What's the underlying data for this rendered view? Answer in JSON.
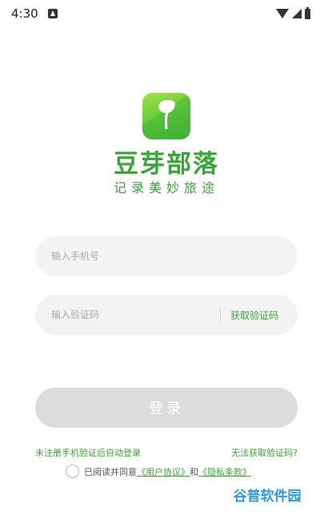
{
  "status_bar": {
    "time": "4:30",
    "icons": [
      "notification-icon",
      "wifi-icon",
      "signal-icon",
      "battery-icon"
    ]
  },
  "brand": {
    "name": "豆芽部落",
    "slogan": "记录美妙旅途",
    "color": "#3aa33a"
  },
  "form": {
    "phone_placeholder": "输入手机号",
    "code_placeholder": "输入验证码",
    "get_code_label": "获取验证码",
    "login_label": "登录"
  },
  "hints": {
    "auto_register": "未注册手机验证后自动登录",
    "cannot_get_code": "无法获取验证码?"
  },
  "agreement": {
    "prefix": "已阅读并同意",
    "user_agreement": "《用户协议》",
    "and": "和",
    "privacy_policy": "《隐私条款》"
  },
  "watermark": {
    "text": "谷普软件园"
  }
}
